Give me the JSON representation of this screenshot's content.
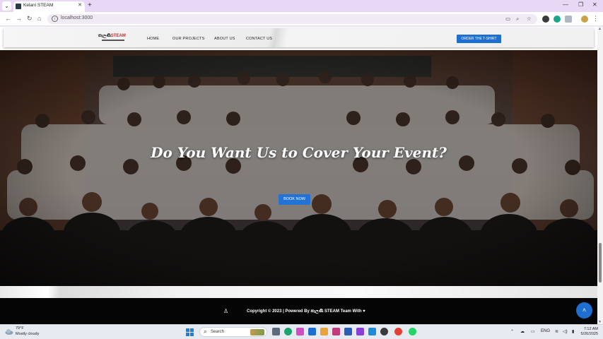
{
  "browser": {
    "tab_title": "Kelani STEAM",
    "url": "localhost:3000",
    "colors": {
      "frame": "#e9d7f6",
      "toolbar": "#ffffff"
    }
  },
  "site": {
    "logo_prefix": "කැලණි",
    "logo_brand": "STEAM",
    "nav": [
      "HOME",
      "OUR PROJECTS",
      "ABOUT US",
      "CONTACT US"
    ],
    "cta_label": "ORDER THE T-SHIRT",
    "hero": {
      "title": "Do You Want Us to Cover Your Event?",
      "button_label": "BOOK NOW"
    },
    "footer": {
      "text": "Copyright © 2023 | Powered By කැලණි STEAM Team With ♥"
    },
    "colors": {
      "accent": "#1e6fd0",
      "footer_bg": "#050505"
    }
  },
  "taskbar": {
    "weather_temp": "79°F",
    "weather_desc": "Mostly cloudy",
    "search_placeholder": "Search",
    "language": "ENG",
    "time": "7:12 AM",
    "date": "5/26/2025"
  }
}
